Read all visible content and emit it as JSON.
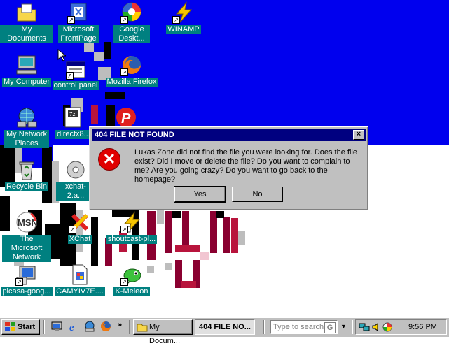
{
  "desktop": {
    "icons": [
      {
        "label": "My Documents",
        "icon": "folder-documents-icon"
      },
      {
        "label": "Microsoft FrontPage",
        "icon": "frontpage-icon"
      },
      {
        "label": "Google Deskt...",
        "icon": "google-desktop-icon"
      },
      {
        "label": "WINAMP",
        "icon": "winamp-icon"
      },
      {
        "label": "My Computer",
        "icon": "computer-icon"
      },
      {
        "label": "control panel",
        "icon": "control-panel-icon"
      },
      {
        "label": "Mozilla Firefox",
        "icon": "firefox-icon"
      },
      {
        "label": "My Network Places",
        "icon": "network-icon"
      },
      {
        "label": "directx8...",
        "icon": "directx-icon"
      },
      {
        "label": "Recycle Bin",
        "icon": "recycle-bin-icon"
      },
      {
        "label": "xchat-2.a...",
        "icon": "xchat-installer-icon"
      },
      {
        "label": "The Microsoft Network",
        "icon": "msn-icon"
      },
      {
        "label": "XChat",
        "icon": "xchat-icon"
      },
      {
        "label": "shoutcast-pl...",
        "icon": "shoutcast-icon"
      },
      {
        "label": "picasa-goog...",
        "icon": "picasa-installer-icon"
      },
      {
        "label": "CAMYIV7E....",
        "icon": "document-icon"
      },
      {
        "label": "K-Meleon",
        "icon": "kmeleon-icon"
      }
    ]
  },
  "dialog": {
    "title": "404 FILE NOT FOUND",
    "close_label": "×",
    "message": "Lukas Zone did not find the file you were looking for. Does the file exist? Did I move or delete the file? Do you want to complain to me? Are you going crazy? Do you want to go back to the homepage?",
    "yes_label": "Yes",
    "no_label": "No"
  },
  "taskbar": {
    "start_label": "Start",
    "tasks": [
      {
        "label": "My Docum...",
        "active": false
      },
      {
        "label": "404 FILE NO...",
        "active": true
      }
    ],
    "search_placeholder": "Type to search",
    "search_engine_glyph": "G",
    "clock": "9:56 PM",
    "overflow_glyph": "»"
  },
  "colors": {
    "desktop_blue": "#0000ee",
    "label_bg": "#008080",
    "titlebar": "#000080",
    "error_red": "#e00000"
  }
}
